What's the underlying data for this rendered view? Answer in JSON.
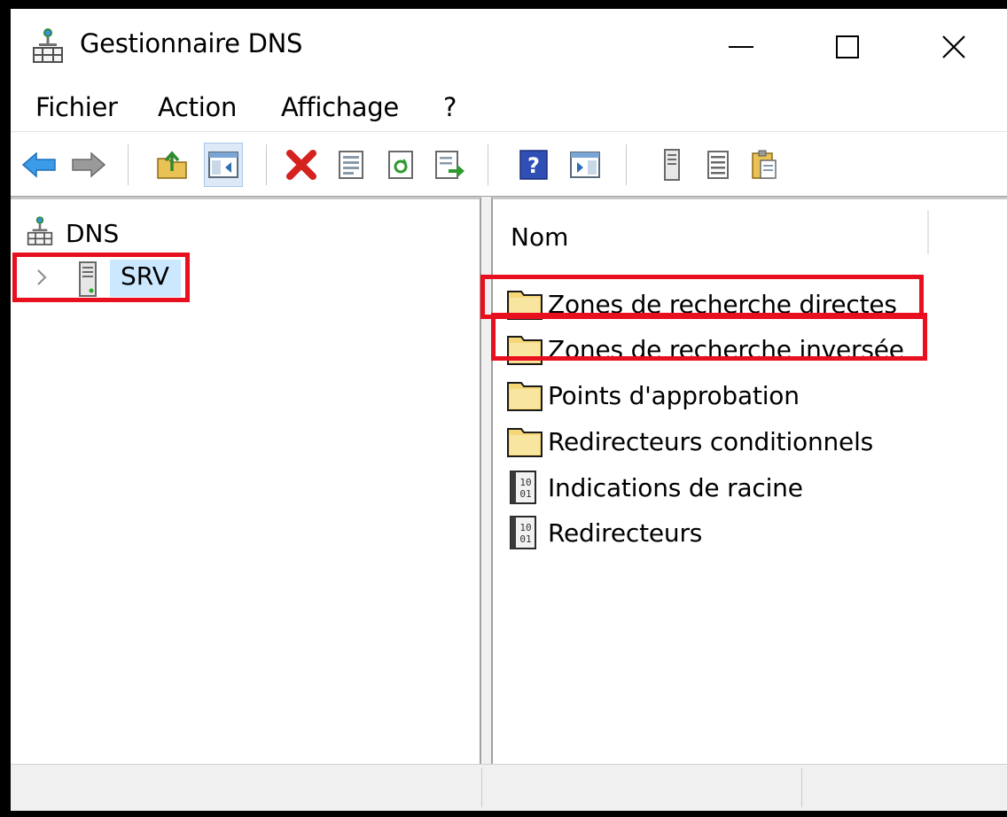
{
  "window": {
    "title": "Gestionnaire DNS",
    "controls": [
      "minimize",
      "maximize",
      "close"
    ]
  },
  "menu": {
    "items": [
      "Fichier",
      "Action",
      "Affichage",
      "?"
    ]
  },
  "toolbar": {
    "buttons": [
      "back-arrow-icon",
      "forward-arrow-icon",
      "up-folder-icon",
      "show-hide-tree-icon",
      "delete-icon",
      "properties-icon",
      "refresh-icon",
      "export-list-icon",
      "help-icon",
      "action-pane-icon",
      "server-icon",
      "list-icon",
      "clipboard-icon"
    ]
  },
  "tree": {
    "root_label": "DNS",
    "server_label": "SRV"
  },
  "list": {
    "column_header": "Nom",
    "items": [
      {
        "label": "Zones de recherche directes",
        "icon": "folder-icon"
      },
      {
        "label": "Zones de recherche inversée",
        "icon": "folder-icon"
      },
      {
        "label": "Points d'approbation",
        "icon": "folder-icon"
      },
      {
        "label": "Redirecteurs conditionnels",
        "icon": "folder-icon"
      },
      {
        "label": "Indications de racine",
        "icon": "binary-doc-icon"
      },
      {
        "label": "Redirecteurs",
        "icon": "binary-doc-icon"
      }
    ]
  },
  "colors": {
    "highlight_box": "#e8101e",
    "selection": "#cce8ff",
    "folder": "#f5d778"
  }
}
